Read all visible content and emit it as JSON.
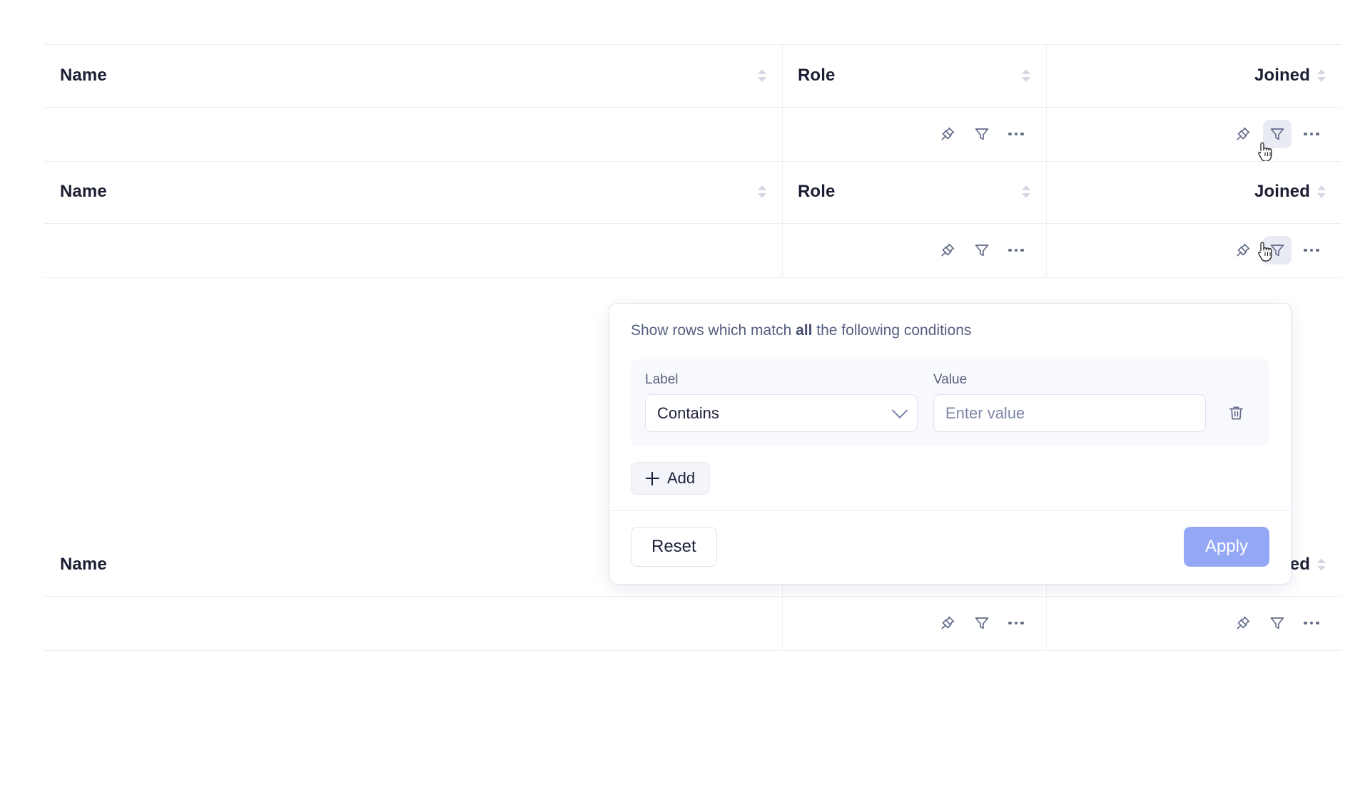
{
  "table": {
    "columns": [
      {
        "key": "name",
        "label": "Name",
        "align": "left",
        "sort_icon": "sort-arrows-icon"
      },
      {
        "key": "role",
        "label": "Role",
        "align": "left",
        "sort_icon": "sort-arrows-icon"
      },
      {
        "key": "joined",
        "label": "Joined",
        "align": "right",
        "sort_icon": "sort-arrows-icon"
      }
    ],
    "header_actions": {
      "pin": "pin-icon",
      "filter": "filter-icon",
      "more": "more-options-icon"
    },
    "sections": [
      {
        "id": "section-1",
        "filter_active_column": "joined",
        "cursor": true
      },
      {
        "id": "section-2",
        "filter_active_column": "joined",
        "cursor": true
      },
      {
        "id": "section-3",
        "filter_active_column": null,
        "cursor": false
      }
    ]
  },
  "filter_popup": {
    "title_prefix": "Show rows which match ",
    "title_emphasis": "all",
    "title_suffix": " the following conditions",
    "condition": {
      "label_caption": "Label",
      "operator_value": "Contains",
      "operator_chevron": "chevron-down-icon",
      "value_caption": "Value",
      "value_text": "",
      "value_placeholder": "Enter value",
      "delete_icon": "trash-icon"
    },
    "add_label": "Add",
    "add_icon": "plus-icon",
    "reset_label": "Reset",
    "apply_label": "Apply"
  },
  "colors": {
    "accent": "#93a7f5",
    "header_text": "#1c1f33",
    "muted_text": "#565f80",
    "border": "#dfe2f0",
    "grid_line": "#eceef6",
    "icon": "#636b8a",
    "icon_active_bg": "#e9ebf4",
    "panel_bg": "#f8f9fc"
  }
}
